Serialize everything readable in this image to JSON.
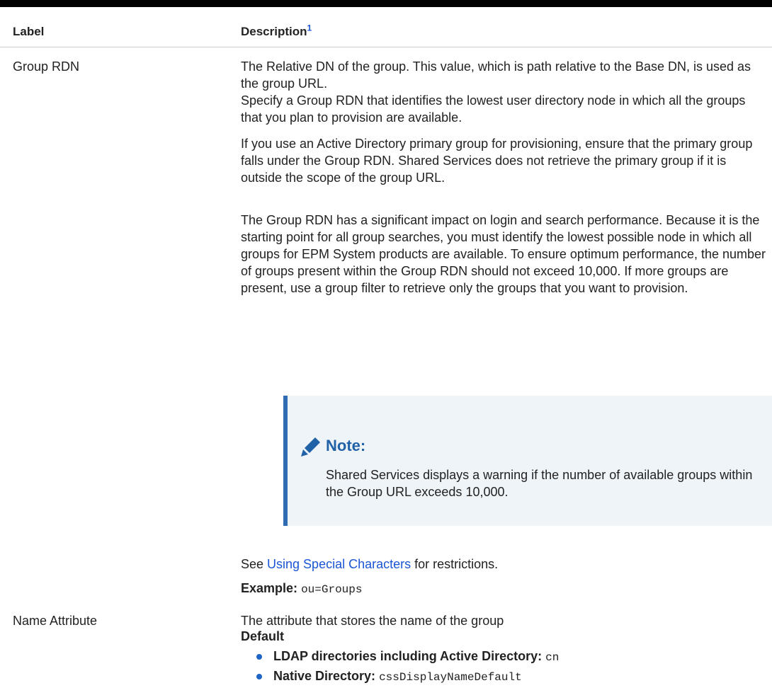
{
  "table": {
    "header": {
      "label": "Label",
      "description": "Description",
      "footnote": "1"
    },
    "rows": {
      "group_rdn": {
        "label": "Group RDN",
        "p1": "The Relative DN of the group. This value, which is path relative to the Base DN, is used as the group URL.",
        "p1b": "Specify a Group RDN that identifies the lowest user directory node in which all the groups that you plan to provision are available.",
        "p2": "If you use an Active Directory primary group for provisioning, ensure that the primary group falls under the Group RDN. Shared Services does not retrieve the primary group if it is outside the scope of the group URL.",
        "p3": "The Group RDN has a significant impact on login and search performance. Because it is the starting point for all group searches, you must identify the lowest possible node in which all groups for EPM System products are available. To ensure optimum performance, the number of groups present within the Group RDN should not exceed 10,000. If more groups are present, use a group filter to retrieve only the groups that you want to provision.",
        "note": {
          "icon": "pencil-icon",
          "title": "Note:",
          "text": "Shared Services displays a warning if the number of available groups within the Group URL exceeds 10,000."
        },
        "see_prefix": "See ",
        "see_link": "Using Special Characters",
        "see_suffix": " for restrictions.",
        "example_label": "Example:",
        "example_value": "ou=Groups"
      },
      "name_attribute": {
        "label": "Name Attribute",
        "desc": "The attribute that stores the name of the group",
        "default_label": "Default",
        "bullets": [
          {
            "label": "LDAP directories including Active Directory:",
            "value": "cn"
          },
          {
            "label": "Native Directory:",
            "value": "cssDisplayNameDefault"
          }
        ]
      }
    }
  },
  "colors": {
    "link": "#1a55d6",
    "note_bg": "#eff4f9",
    "note_border": "#2f6cb3",
    "note_title": "#2161a8",
    "bullet": "#1f65c6"
  }
}
